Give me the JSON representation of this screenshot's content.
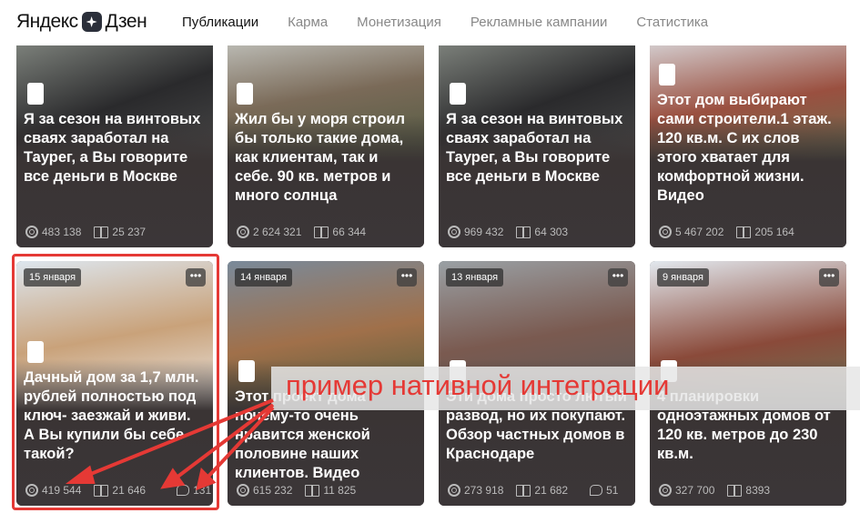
{
  "header": {
    "logo": "Яндекс Дзен",
    "nav": [
      "Публикации",
      "Карма",
      "Монетизация",
      "Рекламные кампании",
      "Статистика"
    ]
  },
  "cards": [
    {
      "title": "Я за сезон на винтовых сваях заработал на Таурег, а Вы говорите все деньги в Москве",
      "views": "483 138",
      "reads": "25 237"
    },
    {
      "title": "Жил бы у моря строил бы только такие дома, как клиентам, так и себе. 90 кв. метров и много солнца",
      "views": "2 624 321",
      "reads": "66 344"
    },
    {
      "title": "Я за сезон на винтовых сваях заработал на Таурег, а Вы говорите все деньги в Москве",
      "views": "969 432",
      "reads": "64 303"
    },
    {
      "title": "Этот дом выбирают сами строители.1 этаж. 120 кв.м. С их слов этого хватает для комфортной жизни. Видео",
      "views": "5 467 202",
      "reads": "205 164"
    },
    {
      "date": "15 января",
      "title": "Дачный дом за 1,7 млн. рублей полностью под ключ- заезжай и живи. А Вы купили бы себе такой?",
      "views": "419 544",
      "reads": "21 646",
      "comments": "131"
    },
    {
      "date": "14 января",
      "title": "Этот проект дома почему-то очень нравится женской половине наших клиентов. Видео",
      "views": "615 232",
      "reads": "11 825"
    },
    {
      "date": "13 января",
      "title": "Эти дома просто лютый развод, но их покупают. Обзор частных домов в Краснодаре",
      "views": "273 918",
      "reads": "21 682",
      "comments": "51"
    },
    {
      "date": "9 января",
      "title": "4 планировки одноэтажных домов от 120 кв. метров до 230 кв.м.",
      "views": "327 700",
      "reads": "8393"
    }
  ],
  "annotation": "пример нативной интеграции",
  "colors": {
    "accent": "#e53935"
  }
}
